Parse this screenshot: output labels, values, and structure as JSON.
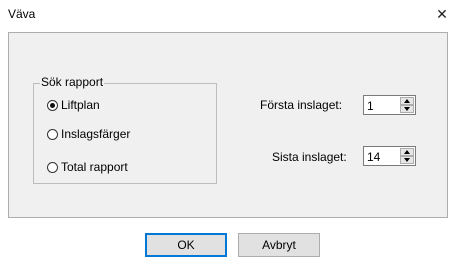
{
  "window": {
    "title": "Väva",
    "close_glyph": "✕"
  },
  "report_group": {
    "legend": "Sök rapport",
    "options": [
      {
        "label": "Liftplan",
        "checked": true
      },
      {
        "label": "Inslagsfärger",
        "checked": false
      },
      {
        "label": "Total rapport",
        "checked": false
      }
    ]
  },
  "first_pick": {
    "label": "Första inslaget:",
    "value": "1"
  },
  "last_pick": {
    "label": "Sista inslaget:",
    "value": "14"
  },
  "buttons": {
    "ok": "OK",
    "cancel": "Avbryt"
  },
  "colors": {
    "focus_border": "#0078d7",
    "panel_bg": "#f0f0f0"
  }
}
